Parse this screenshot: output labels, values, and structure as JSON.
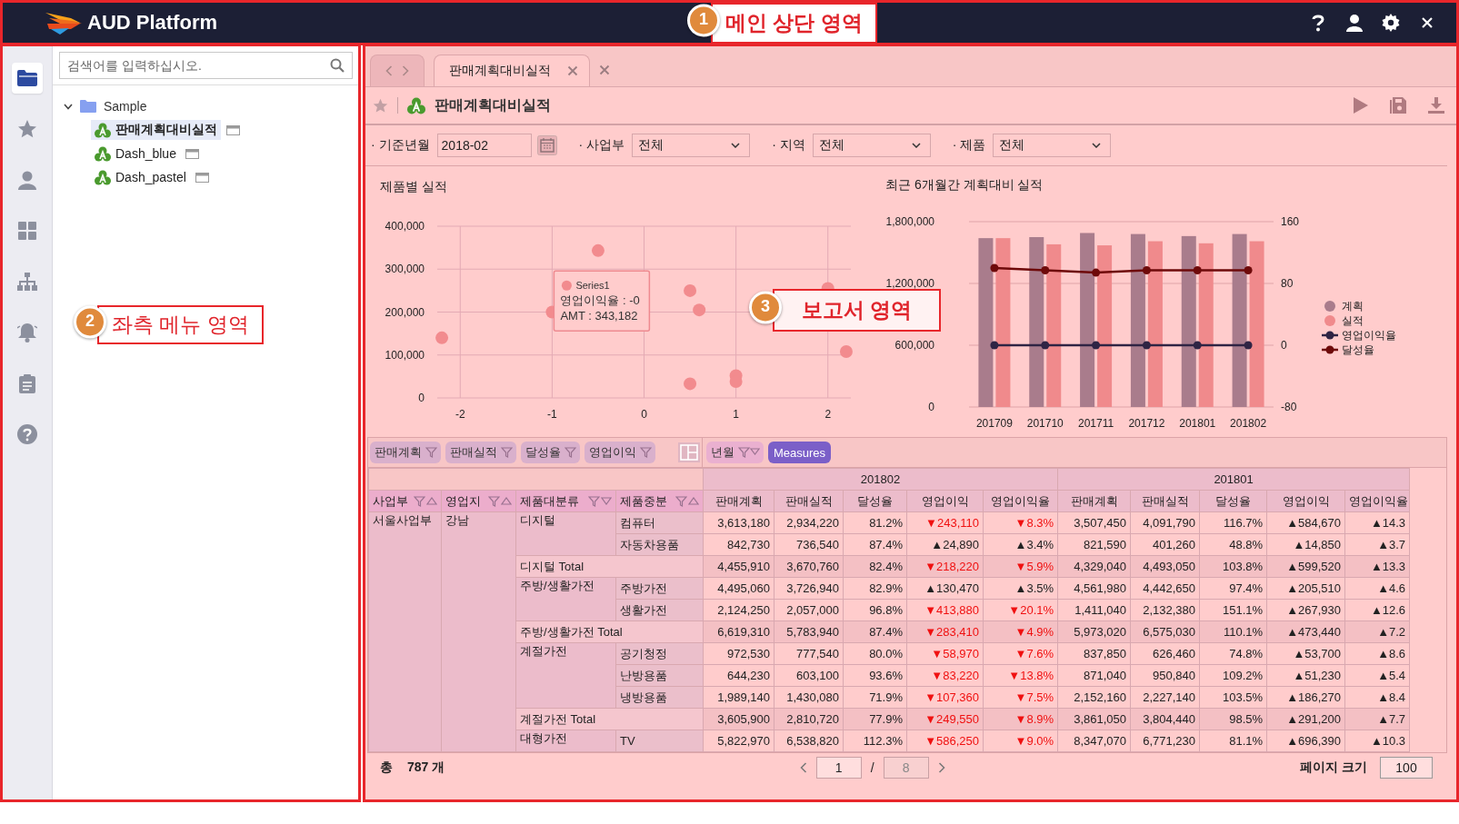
{
  "header": {
    "title": "AUD Platform"
  },
  "callouts": [
    {
      "number": "1",
      "label": "메인 상단 영역"
    },
    {
      "number": "2",
      "label": "좌측 메뉴 영역"
    },
    {
      "number": "3",
      "label": "보고서 영역"
    }
  ],
  "sidebar": {
    "rail": [
      {
        "kind": "folder",
        "selected": true
      },
      {
        "kind": "star",
        "selected": false
      },
      {
        "kind": "user",
        "selected": false
      },
      {
        "kind": "dashboard",
        "selected": false
      },
      {
        "kind": "org",
        "selected": false
      },
      {
        "kind": "bell",
        "selected": false
      },
      {
        "kind": "clipboard",
        "selected": false
      },
      {
        "kind": "help",
        "selected": false
      }
    ],
    "search": {
      "placeholder": "검색어를 입력하십시오."
    },
    "tree": [
      {
        "label": "Sample",
        "expanded": true,
        "children": [
          {
            "label": "판매계획대비실적",
            "selected": true
          },
          {
            "label": "Dash_blue",
            "selected": false
          },
          {
            "label": "Dash_pastel",
            "selected": false
          }
        ]
      }
    ]
  },
  "tabs": [
    {
      "label": "판매계획대비실적",
      "selected": true
    }
  ],
  "report": {
    "title": "판매계획대비실적",
    "favorite": false
  },
  "filters": [
    {
      "label": "· 기준년월",
      "kind": "date",
      "value": "2018-02"
    },
    {
      "label": "· 사업부",
      "kind": "select",
      "value": "전체"
    },
    {
      "label": "· 지역",
      "kind": "select",
      "value": "전체"
    },
    {
      "label": "· 제품",
      "kind": "select",
      "value": "전체"
    }
  ],
  "charts": [
    {
      "chart_data": {
        "type": "scatter",
        "title": "제품별 실적",
        "grid": true,
        "xlim": [
          -2.25,
          2.25
        ],
        "ylim": [
          0,
          400000
        ],
        "xticks": [
          {
            "value": -2,
            "label": "-2"
          },
          {
            "value": -1,
            "label": "-1"
          },
          {
            "value": 0,
            "label": "0"
          },
          {
            "value": 1,
            "label": "1"
          },
          {
            "value": 2,
            "label": "2"
          }
        ],
        "x": [
          -2.2,
          -1,
          -0.5,
          0.5,
          0.6,
          0.5,
          1,
          1,
          2,
          2.2
        ],
        "yticks": [
          {
            "value": 0,
            "label": "0"
          },
          {
            "value": 100000,
            "label": "100,000"
          },
          {
            "value": 200000,
            "label": "200,000"
          },
          {
            "value": 300000,
            "label": "300,000"
          },
          {
            "value": 400000,
            "label": "400,000"
          }
        ],
        "series": [
          {
            "name": "Series1",
            "color": "#f28b8e",
            "values": [
              140000,
              200000,
              343182,
              250000,
              205000,
              33000,
              52000,
              38000,
              255000,
              108000
            ]
          }
        ]
      },
      "tooltip": {
        "lines": [
          "영업이익율 : -0",
          "AMT : 343,182"
        ]
      }
    },
    {
      "chart_data": {
        "type": "bar",
        "title": "최근 6개월간 계획대비 실적",
        "categories": [
          "201709",
          "201710",
          "201711",
          "201712",
          "201801",
          "201802"
        ],
        "ylim": [
          0,
          1800000
        ],
        "yticks": [
          {
            "value": 0,
            "label": "0"
          },
          {
            "value": 600000,
            "label": "600,000"
          },
          {
            "value": 1200000,
            "label": "1,200,000"
          },
          {
            "value": 1800000,
            "label": "1,800,000"
          }
        ],
        "grid": true,
        "y2lim": [
          -80,
          160
        ],
        "y2ticks": [
          -80,
          0,
          80,
          160
        ],
        "legend": "right",
        "series": [
          {
            "name": "계획",
            "color": "#a97c8c",
            "type": "bar",
            "values": [
              1640000,
              1650000,
              1690000,
              1680000,
              1660000,
              1680000
            ]
          },
          {
            "name": "실적",
            "color": "#f08a8c",
            "type": "bar",
            "values": [
              1640000,
              1580000,
              1570000,
              1610000,
              1590000,
              1610000
            ]
          },
          {
            "name": "영업이익율",
            "color": "#2f2444",
            "type": "line",
            "axis": "y2",
            "marker": "o",
            "values": [
              0,
              0,
              0,
              0,
              0,
              0
            ]
          },
          {
            "name": "달성율",
            "color": "#6e0a0a",
            "type": "line",
            "axis": "y2",
            "marker": "o",
            "values": [
              100,
              97,
              94,
              97,
              97,
              97
            ]
          }
        ]
      }
    }
  ],
  "pivot": {
    "measure_chips": [
      "판매계획",
      "판매실적",
      "달성율",
      "영업이익"
    ],
    "column_chips": [
      {
        "label": "년월",
        "kind": "dimension"
      },
      {
        "label": "Measures",
        "kind": "measures"
      }
    ],
    "years": [
      {
        "label": "201802",
        "measures": [
          "판매계획",
          "판매실적",
          "달성율",
          "영업이익",
          "영업이익율"
        ]
      },
      {
        "label": "201801",
        "measures": [
          "판매계획",
          "판매실적",
          "달성율",
          "영업이익",
          "영업이익율"
        ]
      }
    ],
    "row_fields": [
      {
        "label": "사업부",
        "ascending": true
      },
      {
        "label": "영업지",
        "ascending": true
      },
      {
        "label": "제품대분류",
        "ascending": false
      },
      {
        "label": "제품중분",
        "ascending": true
      }
    ],
    "body": {
      "business": "서울사업부",
      "region": "강남",
      "categories": [
        {
          "name": "디지털",
          "items": [
            {
              "name": "컴퓨터",
              "cells": [
                "3,613,180",
                "2,934,220",
                "81.2%",
                {
                  "text": "▼243,110",
                  "down": true
                },
                {
                  "text": "▼8.3%",
                  "down": true
                },
                "3,507,450",
                "4,091,790",
                "116.7%",
                {
                  "text": "▲584,670",
                  "down": false
                },
                {
                  "text": "▲14.3",
                  "down": false
                }
              ]
            },
            {
              "name": "자동차용품",
              "cells": [
                "842,730",
                "736,540",
                "87.4%",
                {
                  "text": "▲24,890",
                  "down": false
                },
                {
                  "text": "▲3.4%",
                  "down": false
                },
                "821,590",
                "401,260",
                "48.8%",
                {
                  "text": "▲14,850",
                  "down": false
                },
                {
                  "text": "▲3.7",
                  "down": false
                }
              ]
            }
          ],
          "total": {
            "label": "디지털 Total",
            "cells": [
              "4,455,910",
              "3,670,760",
              "82.4%",
              {
                "text": "▼218,220",
                "down": true
              },
              {
                "text": "▼5.9%",
                "down": true
              },
              "4,329,040",
              "4,493,050",
              "103.8%",
              {
                "text": "▲599,520",
                "down": false
              },
              {
                "text": "▲13.3",
                "down": false
              }
            ]
          }
        },
        {
          "name": "주방/생활가전",
          "items": [
            {
              "name": "주방가전",
              "cells": [
                "4,495,060",
                "3,726,940",
                "82.9%",
                {
                  "text": "▲130,470",
                  "down": false
                },
                {
                  "text": "▲3.5%",
                  "down": false
                },
                "4,561,980",
                "4,442,650",
                "97.4%",
                {
                  "text": "▲205,510",
                  "down": false
                },
                {
                  "text": "▲4.6",
                  "down": false
                }
              ]
            },
            {
              "name": "생활가전",
              "cells": [
                "2,124,250",
                "2,057,000",
                "96.8%",
                {
                  "text": "▼413,880",
                  "down": true
                },
                {
                  "text": "▼20.1%",
                  "down": true
                },
                "1,411,040",
                "2,132,380",
                "151.1%",
                {
                  "text": "▲267,930",
                  "down": false
                },
                {
                  "text": "▲12.6",
                  "down": false
                }
              ]
            }
          ],
          "total": {
            "label": "주방/생활가전 Total",
            "cells": [
              "6,619,310",
              "5,783,940",
              "87.4%",
              {
                "text": "▼283,410",
                "down": true
              },
              {
                "text": "▼4.9%",
                "down": true
              },
              "5,973,020",
              "6,575,030",
              "110.1%",
              {
                "text": "▲473,440",
                "down": false
              },
              {
                "text": "▲7.2",
                "down": false
              }
            ]
          }
        },
        {
          "name": "계절가전",
          "items": [
            {
              "name": "공기청정",
              "cells": [
                "972,530",
                "777,540",
                "80.0%",
                {
                  "text": "▼58,970",
                  "down": true
                },
                {
                  "text": "▼7.6%",
                  "down": true
                },
                "837,850",
                "626,460",
                "74.8%",
                {
                  "text": "▲53,700",
                  "down": false
                },
                {
                  "text": "▲8.6",
                  "down": false
                }
              ]
            },
            {
              "name": "난방용품",
              "cells": [
                "644,230",
                "603,100",
                "93.6%",
                {
                  "text": "▼83,220",
                  "down": true
                },
                {
                  "text": "▼13.8%",
                  "down": true
                },
                "871,040",
                "950,840",
                "109.2%",
                {
                  "text": "▲51,230",
                  "down": false
                },
                {
                  "text": "▲5.4",
                  "down": false
                }
              ]
            },
            {
              "name": "냉방용품",
              "cells": [
                "1,989,140",
                "1,430,080",
                "71.9%",
                {
                  "text": "▼107,360",
                  "down": true
                },
                {
                  "text": "▼7.5%",
                  "down": true
                },
                "2,152,160",
                "2,227,140",
                "103.5%",
                {
                  "text": "▲186,270",
                  "down": false
                },
                {
                  "text": "▲8.4",
                  "down": false
                }
              ]
            }
          ],
          "total": {
            "label": "계절가전 Total",
            "cells": [
              "3,605,900",
              "2,810,720",
              "77.9%",
              {
                "text": "▼249,550",
                "down": true
              },
              {
                "text": "▼8.9%",
                "down": true
              },
              "3,861,050",
              "3,804,440",
              "98.5%",
              {
                "text": "▲291,200",
                "down": false
              },
              {
                "text": "▲7.7",
                "down": false
              }
            ]
          }
        },
        {
          "name": "대형가전",
          "items": [
            {
              "name": "TV",
              "cells": [
                "5,822,970",
                "6,538,820",
                "112.3%",
                {
                  "text": "▼586,250",
                  "down": true
                },
                {
                  "text": "▼9.0%",
                  "down": true
                },
                "8,347,070",
                "6,771,230",
                "81.1%",
                {
                  "text": "▲696,390",
                  "down": false
                },
                {
                  "text": "▲10.3",
                  "down": false
                }
              ]
            }
          ]
        }
      ]
    }
  },
  "footer": {
    "total_label": "총",
    "total": "787 개",
    "page": "1",
    "separator": "/",
    "pages": "8",
    "page_size_label": "페이지 크기",
    "page_size": "100"
  }
}
